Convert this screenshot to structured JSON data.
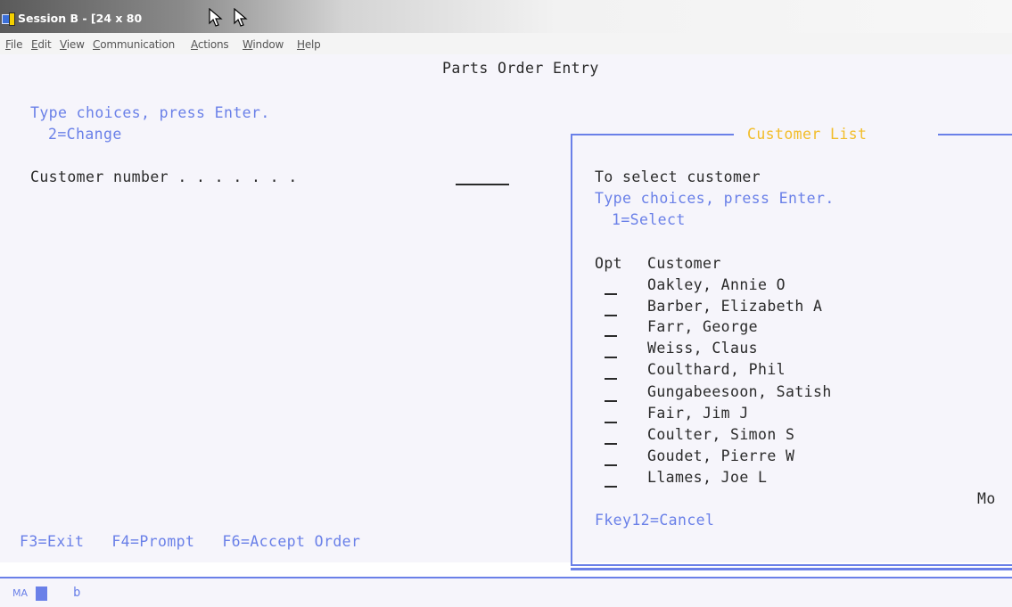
{
  "window": {
    "title": "Session B - [24 x 80"
  },
  "menu": [
    {
      "label": "File",
      "accel": "F",
      "rest": "ile"
    },
    {
      "label": "Edit",
      "accel": "E",
      "rest": "dit"
    },
    {
      "label": "View",
      "accel": "V",
      "rest": "iew"
    },
    {
      "label": "Communication",
      "accel": "C",
      "rest": "ommunication"
    },
    {
      "label": "Actions",
      "accel": "A",
      "rest": "ctions"
    },
    {
      "label": "Window",
      "accel": "W",
      "rest": "indow"
    },
    {
      "label": "Help",
      "accel": "H",
      "rest": "elp"
    }
  ],
  "main": {
    "title": "Parts Order Entry",
    "instruction": "Type choices, press Enter.",
    "option": "2=Change",
    "customer_label": "Customer number . . . . . . .",
    "fkeys": "F3=Exit   F4=Prompt   F6=Accept Order"
  },
  "popup": {
    "title": "Customer List",
    "header1": "To select customer",
    "instruction": "Type choices, press Enter.",
    "option": "1=Select",
    "col_opt": "Opt",
    "col_customer": "Customer",
    "customers": [
      "Oakley, Annie O",
      "Barber, Elizabeth A",
      "Farr, George",
      "Weiss, Claus",
      "Coulthard, Phil",
      "Gungabeesoon, Satish",
      "Fair, Jim J",
      "Coulter, Simon S",
      "Goudet, Pierre W",
      "Llames, Joe L"
    ],
    "more": "Mo",
    "fkey": "Fkey12=Cancel"
  },
  "status": {
    "mode": "MA",
    "value": "b"
  },
  "colors": {
    "screen_bg": "#f6f5fb",
    "field_blue": "#6a80e8",
    "text_dark": "#2a2a2a",
    "title_yellow": "#f2bd2a"
  }
}
